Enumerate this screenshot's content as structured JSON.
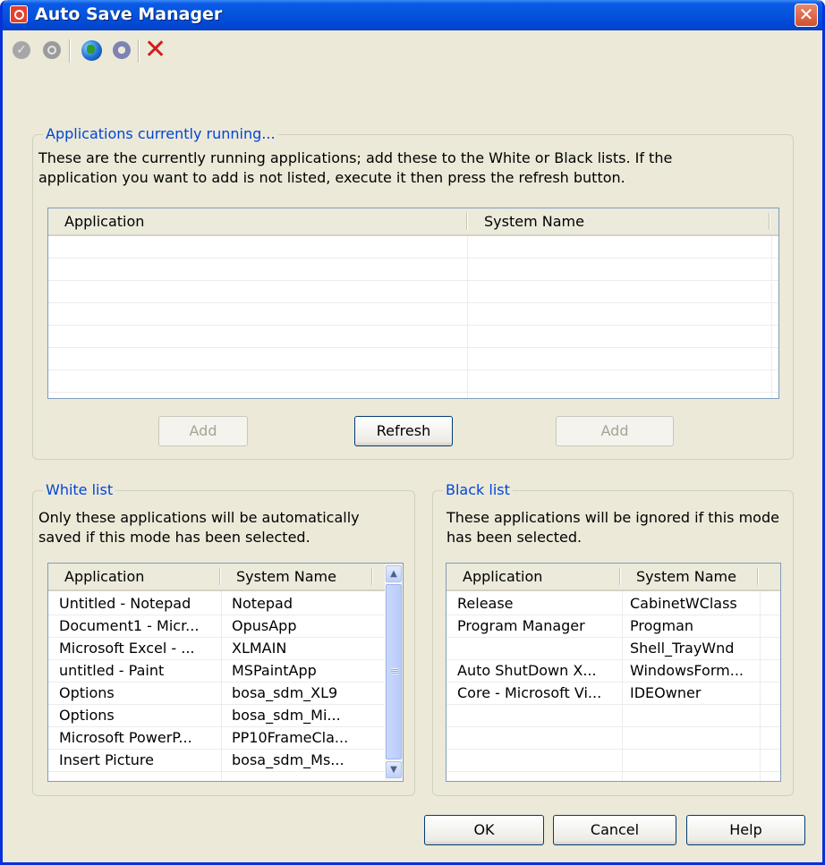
{
  "window": {
    "title": "Auto Save Manager",
    "close_symbol": "✕"
  },
  "toolbar": {
    "icons": [
      "check-disabled-icon",
      "stop-disabled-icon",
      "globe-icon",
      "gear-icon",
      "delete-icon"
    ],
    "delete_symbol": "✕"
  },
  "running": {
    "legend": "Applications currently running...",
    "description_line1": "These are the currently running applications; add these to the White or Black lists. If the",
    "description_line2": "application you want to add is not listed, execute it then press the refresh button.",
    "columns": [
      "Application",
      "System Name"
    ],
    "rows": [],
    "add_left_label": "Add",
    "refresh_label": "Refresh",
    "add_right_label": "Add"
  },
  "white_list": {
    "legend": "White list",
    "description_line1": "Only these applications will be automatically",
    "description_line2": "saved if this mode has been selected.",
    "columns": [
      "Application",
      "System Name"
    ],
    "rows": [
      [
        "Untitled - Notepad",
        "Notepad"
      ],
      [
        "Document1 - Micr...",
        "OpusApp"
      ],
      [
        "Microsoft Excel - ...",
        "XLMAIN"
      ],
      [
        "untitled - Paint",
        "MSPaintApp"
      ],
      [
        "Options",
        "bosa_sdm_XL9"
      ],
      [
        "Options",
        "bosa_sdm_Mi..."
      ],
      [
        "Microsoft PowerP...",
        "PP10FrameCla..."
      ],
      [
        "Insert Picture",
        "bosa_sdm_Ms..."
      ]
    ]
  },
  "black_list": {
    "legend": "Black list",
    "description_line1": "These applications will be ignored if this mode",
    "description_line2": "has been selected.",
    "columns": [
      "Application",
      "System Name"
    ],
    "rows": [
      [
        "Release",
        "CabinetWClass"
      ],
      [
        "Program Manager",
        "Progman"
      ],
      [
        "",
        "Shell_TrayWnd"
      ],
      [
        "Auto ShutDown X...",
        "WindowsForm..."
      ],
      [
        "Core - Microsoft Vi...",
        "IDEOwner"
      ]
    ]
  },
  "footer": {
    "ok_label": "OK",
    "cancel_label": "Cancel",
    "help_label": "Help"
  }
}
